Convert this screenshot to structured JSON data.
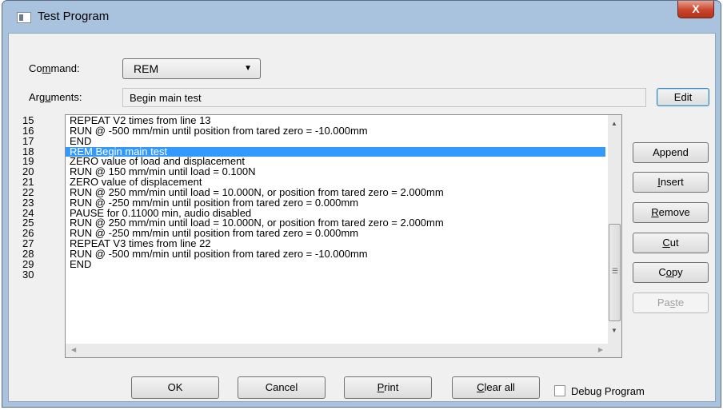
{
  "window": {
    "title": "Test Program",
    "close_label": "X"
  },
  "command": {
    "label_pre": "Co",
    "label_ul": "m",
    "label_post": "mand:",
    "value": "REM"
  },
  "arguments": {
    "label_pre": "Arg",
    "label_ul": "u",
    "label_post": "ments:",
    "value": "Begin main test"
  },
  "buttons": {
    "edit": "Edit",
    "append": "Append",
    "insert": {
      "ul": "I",
      "rest": "nsert"
    },
    "remove": {
      "ul": "R",
      "rest": "emove"
    },
    "cut": {
      "ul": "C",
      "rest": "ut"
    },
    "copy": {
      "pre": "C",
      "ul": "o",
      "rest": "py"
    },
    "paste": {
      "pre": "Pa",
      "ul": "s",
      "rest": "te"
    },
    "ok": "OK",
    "cancel": "Cancel",
    "print": {
      "ul": "P",
      "rest": "rint"
    },
    "clear_all": {
      "ul": "C",
      "rest": "lear all"
    }
  },
  "debug_label": "Debug Program",
  "line_numbers": [
    "15",
    "16",
    "17",
    "18",
    "19",
    "20",
    "21",
    "22",
    "23",
    "24",
    "25",
    "26",
    "27",
    "28",
    "29",
    "30"
  ],
  "program_lines": [
    "REPEAT V2 times from line 13",
    "RUN @ -500 mm/min until position from tared zero = -10.000mm",
    "END",
    "REM Begin main test",
    "ZERO value of load and displacement",
    "RUN @ 150 mm/min until load = 0.100N",
    "ZERO value of displacement",
    "RUN @ 250 mm/min until load = 10.000N, or position from tared zero = 2.000mm",
    "RUN @ -250 mm/min until position from tared zero = 0.000mm",
    "PAUSE for 0.11000 min, audio disabled",
    "RUN @ 250 mm/min until load = 10.000N, or position from tared zero = 2.000mm",
    "RUN @ -250 mm/min until position from tared zero = 0.000mm",
    "REPEAT V3 times from line 22",
    "RUN @ -500 mm/min until position from tared zero = -10.000mm",
    "END"
  ],
  "selected_index": 3,
  "colors": {
    "selection": "#3399ff",
    "frame": "#a9c3de"
  }
}
